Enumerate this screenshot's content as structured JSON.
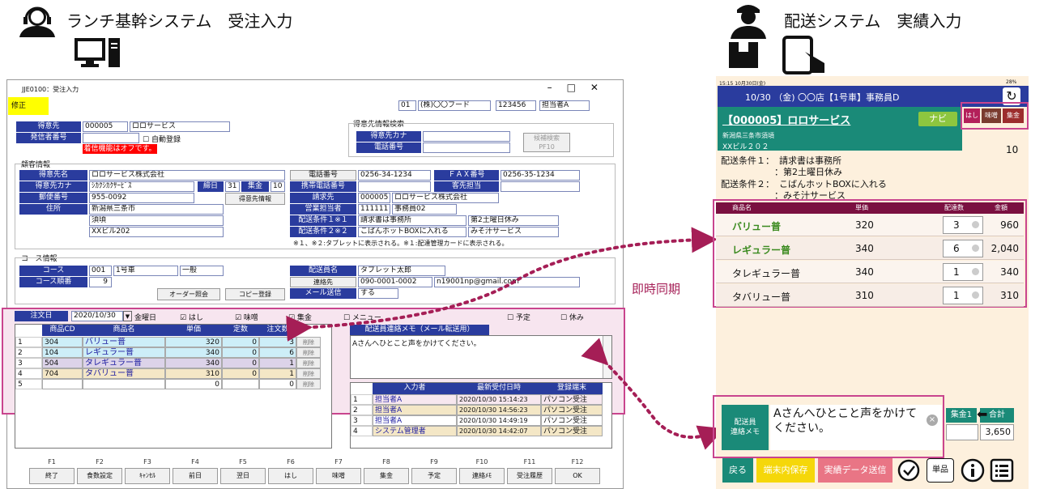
{
  "left_system": {
    "title": "ランチ基幹システム　受注入力"
  },
  "right_system": {
    "title": "配送システム　実績入力"
  },
  "sync_label": "即時同期",
  "win": {
    "title": "JJE0100：受注入力",
    "mode": "修正",
    "header": [
      "01",
      "(株)〇〇フード",
      "123456",
      "担当者A"
    ]
  },
  "cust": {
    "code_label": "得意先",
    "code": "000005",
    "name": "ロロサービス",
    "caller_label": "発信者番号",
    "auto_reg": "自動登録",
    "warning": "着信機能はオフです。"
  },
  "search": {
    "title": "得意先情報検索",
    "kana_label": "得意先カナ",
    "phone_label": "電話番号",
    "btn": "候補検索\nPF10"
  },
  "info": {
    "title": "顧客情報",
    "name_label": "得意先名",
    "name": "ロロサービス株式会社",
    "kana_label": "得意先カナ",
    "kana": "ｼｶｸｼｶｸｻｰﾋﾞｽ",
    "close_label": "締日",
    "close": "31",
    "collect_label": "集金",
    "collect": "10",
    "zip_label": "郵便番号",
    "zip": "955-0092",
    "btn_info": "得意先情報",
    "addr_label": "住所",
    "addr1": "新潟県三条市",
    "addr2": "須頃",
    "addr3": "XXビル202",
    "tel_label": "電話番号",
    "tel": "0256-34-1234",
    "fax_label": "ＦＡＸ番号",
    "fax": "0256-35-1234",
    "mobile_label": "携帯電話番号",
    "contact_label": "客先担当",
    "bill_label": "請求先",
    "bill_code": "000005",
    "bill_name": "ロロサービス株式会社",
    "sales_label": "営業担当者",
    "sales_code": "111111",
    "sales_name": "事務員02",
    "cond1_label": "配送条件１※１",
    "cond1a": "請求書は事務所",
    "cond1b": "第2土曜日休み",
    "cond2_label": "配送条件２※２",
    "cond2a": "こばんホットBOXに入れる",
    "cond2b": "みそ汁サービス",
    "note": "※１、※２:タブレットに表示される。※１:配達管理カードに表示される。"
  },
  "course": {
    "title": "コース情報",
    "course_label": "コース",
    "course_code": "001",
    "course_name": "1号車",
    "course_type": "一般",
    "order_label": "コース順番",
    "order": "9",
    "btn1": "オーダー照会",
    "btn2": "コピー登録",
    "driver_label": "配送員名",
    "driver": "タブレット太郎",
    "contact_label": "連絡先",
    "contact_tel": "090-0001-0002",
    "contact_mail": "n19001np@gmail.com",
    "mail_label": "メール送信",
    "mail": "する"
  },
  "orderbar": {
    "date_label": "注文日",
    "date": "2020/10/30",
    "weekday": "金曜日",
    "checks": [
      "☑ はし",
      "☑ 味噌",
      "☑ 集金",
      "☐ メニュー",
      "☐ 予定",
      "☐ 休み"
    ]
  },
  "order_grid": {
    "headers": [
      "商品CD",
      "商品名",
      "単価",
      "定数",
      "注文数"
    ],
    "rows": [
      [
        "1",
        "304",
        "バリュー普",
        "320",
        "0",
        "3",
        "削除"
      ],
      [
        "2",
        "104",
        "レギュラー普",
        "340",
        "0",
        "6",
        "削除"
      ],
      [
        "3",
        "504",
        "タレギュラー普",
        "340",
        "0",
        "1",
        "削除"
      ],
      [
        "4",
        "704",
        "タバリュー普",
        "310",
        "0",
        "1",
        "削除"
      ],
      [
        "5",
        "",
        "",
        "0",
        "",
        "0",
        "削除"
      ]
    ]
  },
  "memo": {
    "title": "配送員連絡メモ（メール転送用）",
    "text": "Aさんへひとこと声をかけてください。"
  },
  "log": {
    "headers": [
      "入力者",
      "最新受付日時",
      "登録端末"
    ],
    "rows": [
      [
        "1",
        "担当者A",
        "2020/10/30 15:14:23",
        "パソコン受注"
      ],
      [
        "2",
        "担当者A",
        "2020/10/30 14:56:23",
        "パソコン受注"
      ],
      [
        "3",
        "担当者A",
        "2020/10/30 14:49:19",
        "パソコン受注"
      ],
      [
        "4",
        "システム管理者",
        "2020/10/30 14:42:07",
        "パソコン受注"
      ]
    ]
  },
  "fkeys": [
    [
      "F1",
      "終了"
    ],
    [
      "F2",
      "食数設定"
    ],
    [
      "F3",
      "ｷｬﾝｾﾙ"
    ],
    [
      "F4",
      "前日"
    ],
    [
      "F5",
      "翌日"
    ],
    [
      "F6",
      "はし"
    ],
    [
      "F7",
      "味噌"
    ],
    [
      "F8",
      "集金"
    ],
    [
      "F9",
      "予定"
    ],
    [
      "F10",
      "連絡ﾒﾓ"
    ],
    [
      "F11",
      "受注履歴"
    ],
    [
      "F12",
      "OK"
    ]
  ],
  "tablet": {
    "status_left": "15:15  10月30日(金)",
    "status_right": "28%",
    "topbar": "10/30 （金) 〇〇店【1号車】事務員D",
    "customer": "【000005】ロロサービス",
    "navi": "ナビ",
    "tags": [
      "はし",
      "味噌",
      "集金"
    ],
    "addr1": "新潟県三条市須頃",
    "addr2": "XXビル２０２",
    "count": "10",
    "cond1_label": "配送条件１：",
    "cond1a": "請求書は事務所",
    "cond1b": "：第2土曜日休み",
    "cond2_label": "配送条件２：",
    "cond2a": "こばんホットBOXに入れる",
    "cond2b": "：みそ汁サービス",
    "tbl_headers": [
      "商品名",
      "単価",
      "配達数",
      "金額"
    ],
    "rows": [
      [
        "バリュー普",
        "320",
        "3",
        "960"
      ],
      [
        "レギュラー普",
        "340",
        "6",
        "2,040"
      ],
      [
        "タレギュラー普",
        "340",
        "1",
        "340"
      ],
      [
        "タバリュー普",
        "310",
        "1",
        "310"
      ]
    ],
    "memo_label": "配送員\n連絡メモ",
    "memo": "Aさんへひとこと声をかけてください。",
    "collect_label": "集金1",
    "total_label": "合計",
    "total": "3,650",
    "btn_back": "戻る",
    "btn_save": "端末内保存",
    "btn_send": "実績データ送信",
    "btn_single": "単品"
  },
  "colors": {
    "navy": "#2a3c9e",
    "tablet_bg": "#fdf0dd",
    "teal": "#1a8a78",
    "pink": "#d4418e",
    "maroon": "#b3205a"
  }
}
